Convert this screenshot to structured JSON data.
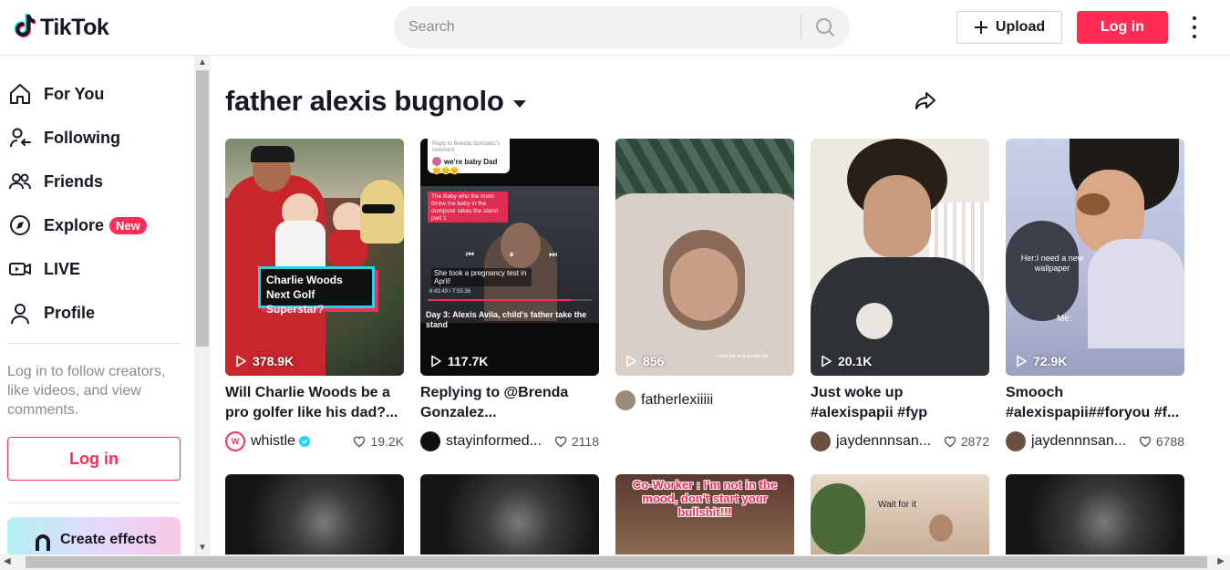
{
  "header": {
    "logo_text": "TikTok",
    "search_placeholder": "Search",
    "upload_label": "Upload",
    "login_label": "Log in"
  },
  "sidebar": {
    "items": [
      {
        "label": "For You",
        "icon": "home-icon"
      },
      {
        "label": "Following",
        "icon": "following-icon"
      },
      {
        "label": "Friends",
        "icon": "friends-icon"
      },
      {
        "label": "Explore",
        "icon": "compass-icon",
        "badge": "New"
      },
      {
        "label": "LIVE",
        "icon": "live-icon"
      },
      {
        "label": "Profile",
        "icon": "profile-icon"
      }
    ],
    "login_prompt": "Log in to follow creators, like videos, and view comments.",
    "login_button": "Log in",
    "create_effects": "Create effects"
  },
  "main": {
    "title": "father alexis bugnolo",
    "videos": [
      {
        "views": "378.9K",
        "caption": "Will Charlie Woods be a pro golfer like his dad?...",
        "author": "whistle",
        "verified": true,
        "likes": "19.2K",
        "overlay": "Charlie Woods Next Golf Superstar?"
      },
      {
        "views": "117.7K",
        "caption": "Replying to @Brenda Gonzalez...",
        "author": "stayinformed...",
        "likes": "2118",
        "reply_header": "Reply to Brenda Gonzalez's comment",
        "reply_text": "we're baby Dad",
        "overlay_top": "The Baby who the mom threw the baby in the dumpster takes the stand part 1",
        "overlay_mid": "She took a pregnancy test in April!",
        "overlay_bottom": "Day 3: Alexis Avila, child's father take the stand",
        "time": "6:43:49 / 7:55:36"
      },
      {
        "views": "856",
        "caption": "",
        "author": "fatherlexiiiii",
        "likes": "",
        "overlay": "i need the luck so why not"
      },
      {
        "views": "20.1K",
        "caption": "Just woke up #alexispapii #fyp",
        "author": "jaydennnsan...",
        "likes": "2872"
      },
      {
        "views": "72.9K",
        "caption": "Smooch #alexispapii##foryou #f...",
        "author": "jaydennnsan...",
        "likes": "6788",
        "overlay_top": "Her:I need a new wallpaper",
        "overlay_bottom": "Me:"
      }
    ],
    "row2": [
      {
        "overlay": ""
      },
      {
        "overlay": ""
      },
      {
        "overlay": "Co-Worker : I'm not in the mood, don't start your bullshit!!!"
      },
      {
        "overlay": "Wait for it"
      },
      {
        "overlay": ""
      }
    ]
  },
  "colors": {
    "brand": "#fe2c55",
    "text": "#161823",
    "muted": "#8a8b91",
    "verified": "#20d5ec"
  }
}
